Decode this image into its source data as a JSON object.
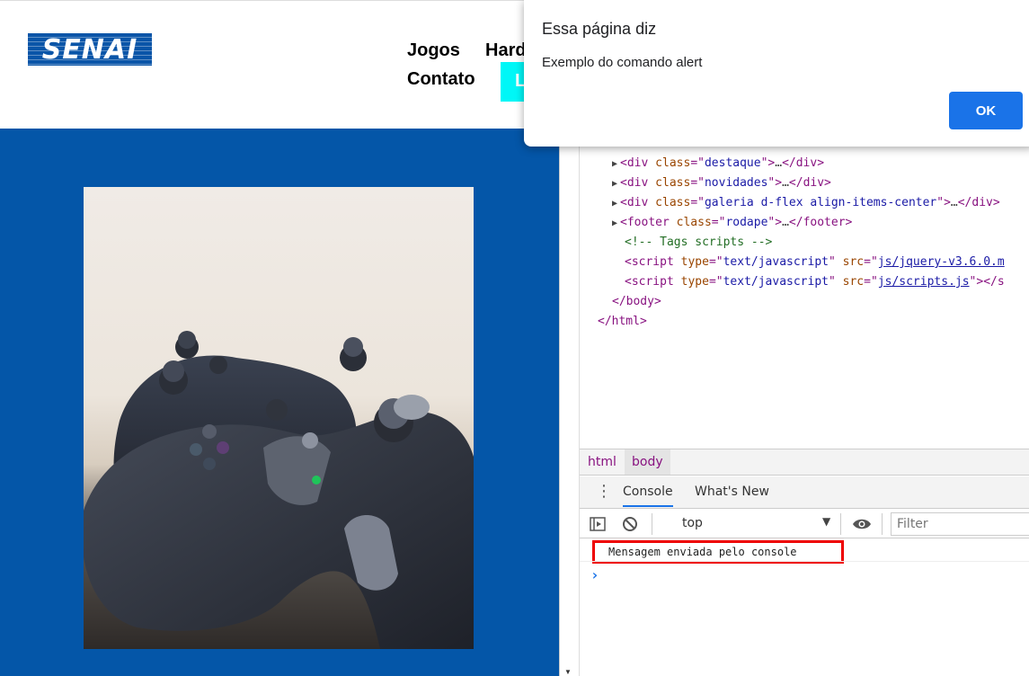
{
  "site": {
    "logo_text": "SENAI",
    "nav": [
      "Jogos",
      "Hard",
      "Contato"
    ],
    "login_partial": "L"
  },
  "devtools": {
    "elements": [
      {
        "indent": 1,
        "arrow": true,
        "tag": "div",
        "attr": "class",
        "value": "destaque",
        "collapsed": true
      },
      {
        "indent": 1,
        "arrow": true,
        "tag": "div",
        "attr": "class",
        "value": "novidades",
        "collapsed": true
      },
      {
        "indent": 1,
        "arrow": true,
        "tag": "div",
        "attr": "class",
        "value": "galeria d-flex align-items-center",
        "collapsed": true
      },
      {
        "indent": 1,
        "arrow": true,
        "tag": "footer",
        "attr": "class",
        "value": "rodape",
        "collapsed": true
      }
    ],
    "comment": "<!-- Tags scripts -->",
    "script1_type": "text/javascript",
    "script1_src": "js/jquery-v3.6.0.m",
    "script2_type": "text/javascript",
    "script2_src": "js/scripts.js",
    "close_body": "</body>",
    "close_html": "</html>",
    "breadcrumbs": [
      "html",
      "body"
    ],
    "drawer_tabs": [
      "Console",
      "What's New"
    ],
    "context": "top",
    "filter_placeholder": "Filter",
    "console_message": "Mensagem enviada pelo console",
    "prompt": "›"
  },
  "alert": {
    "title": "Essa página diz",
    "message": "Exemplo do comando alert",
    "ok_label": "OK"
  },
  "colors": {
    "brand_blue": "#0456a8",
    "login_cyan": "#00f7f7",
    "ok_blue": "#1a73e8",
    "highlight_red": "#ee0000"
  },
  "icons": [
    "sidebar-toggle-icon",
    "clear-console-icon",
    "eye-icon",
    "kebab-menu-icon",
    "triangle-right-icon"
  ]
}
